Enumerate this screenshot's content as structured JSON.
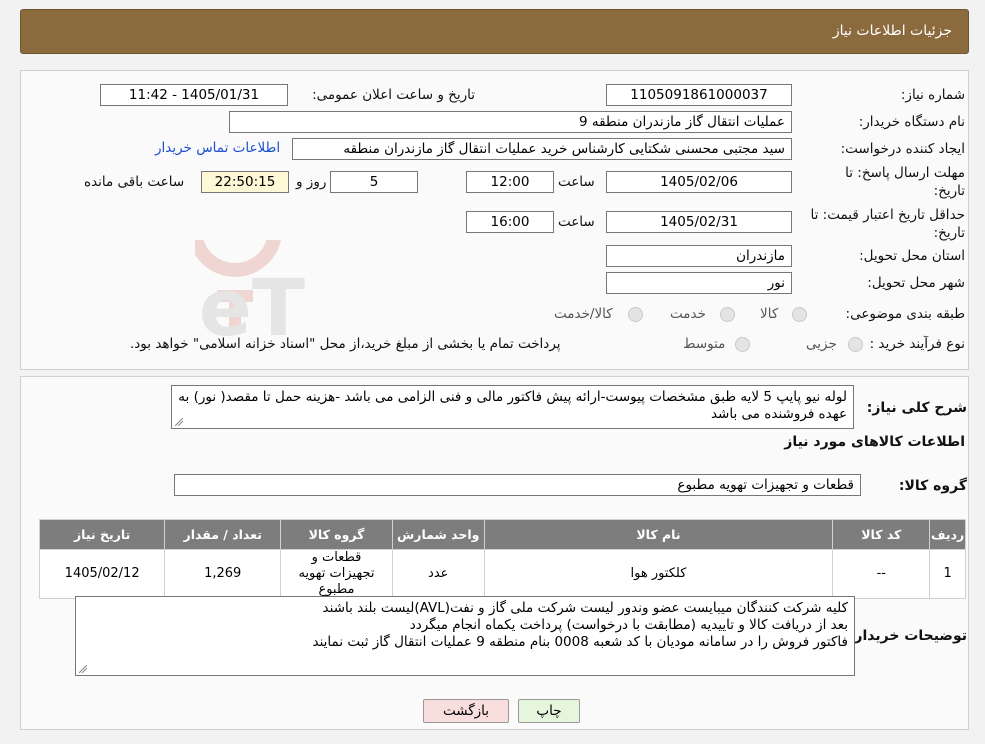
{
  "header": {
    "title": "جزئیات اطلاعات نیاز"
  },
  "form": {
    "need_number": {
      "label": "شماره نیاز:",
      "value": "1105091861000037"
    },
    "announce_datetime": {
      "label": "تاریخ و ساعت اعلان عمومی:",
      "value": "1405/01/31 - 11:42"
    },
    "buyer_org": {
      "label": "نام دستگاه خریدار:",
      "value": "عملیات انتقال گاز مازندران منطقه 9"
    },
    "requester": {
      "label": "ایجاد کننده درخواست:",
      "value": "سید مجتبی محسنی شکتایی کارشناس خرید عملیات انتقال گاز مازندران منطقه",
      "contact_link": "اطلاعات تماس خریدار"
    },
    "reply_deadline": {
      "label_line1": "مهلت ارسال پاسخ: تا",
      "label_line2": "تاریخ:",
      "date": "1405/02/06",
      "time_label": "ساعت",
      "time": "12:00",
      "days": "5",
      "days_label": "روز و",
      "remaining": "22:50:15",
      "remaining_label": "ساعت باقی مانده"
    },
    "price_validity": {
      "label_line1": "حداقل تاریخ اعتبار قیمت: تا",
      "label_line2": "تاریخ:",
      "date": "1405/02/31",
      "time_label": "ساعت",
      "time": "16:00"
    },
    "province": {
      "label": "استان محل تحویل:",
      "value": "مازندران"
    },
    "city": {
      "label": "شهر محل تحویل:",
      "value": "نور"
    },
    "category": {
      "label": "طبقه بندی موضوعی:",
      "options": [
        "کالا",
        "خدمت",
        "کالا/خدمت"
      ]
    },
    "purchase_type": {
      "label": "نوع فرآیند خرید :",
      "options": [
        "جزیی",
        "متوسط"
      ],
      "note": "پرداخت تمام یا بخشی از مبلغ خرید،از محل \"اسناد خزانه اسلامی\" خواهد بود."
    }
  },
  "description": {
    "label": "شرح کلی نیاز:",
    "text": "لوله نیو پایپ 5 لایه طبق مشخصات پیوست-ارائه پیش فاکتور مالی و فنی الزامی می باشد -هزینه حمل تا مقصد( نور) به عهده فروشنده می باشد"
  },
  "goods_section": {
    "title": "اطلاعات کالاهای مورد نیاز"
  },
  "goods_group": {
    "label": "گروه کالا:",
    "value": "قطعات و تجهیزات تهویه مطبوع"
  },
  "table": {
    "headers": [
      "ردیف",
      "کد کالا",
      "نام کالا",
      "واحد شمارش",
      "گروه کالا",
      "تعداد / مقدار",
      "تاریخ نیاز"
    ],
    "rows": [
      {
        "row": "1",
        "code": "--",
        "name": "کلکتور هوا",
        "unit": "عدد",
        "group": "قطعات و تجهیزات تهویه مطبوع",
        "qty": "1,269",
        "date": "1405/02/12"
      }
    ]
  },
  "buyer_notes": {
    "label": "توضیحات خریدار:",
    "lines": [
      "کلیه شرکت کنندگان میبایست عضو وندور لیست شرکت ملی گاز و نفت(AVL)لیست بلند باشند",
      "بعد از دریافت کالا و تاییدیه (مطابقت با درخواست) پرداخت یکماه انجام میگردد",
      "فاکتور فروش را در سامانه مودیان با کد شعبه 0008 بنام منطقه 9 عملیات انتقال گاز ثبت نمایند"
    ]
  },
  "buttons": {
    "print": "چاپ",
    "back": "بازگشت"
  },
  "colors": {
    "header": "#8b6a3e",
    "table_header": "#7d7d7d",
    "back_button": "#f9dede",
    "print_button": "#e6f6dc",
    "link": "#1a4fd0"
  }
}
